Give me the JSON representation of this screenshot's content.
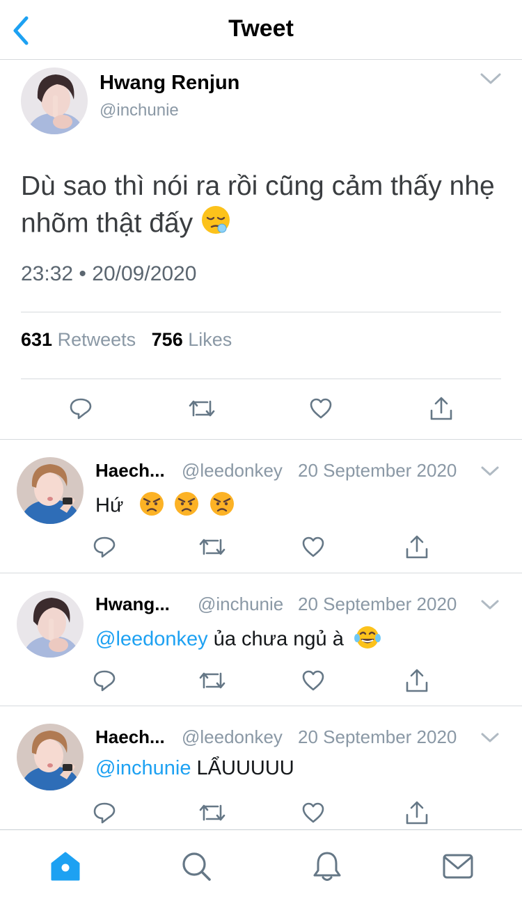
{
  "header": {
    "title": "Tweet",
    "back_icon": "chevron-left-icon",
    "accent": "#1da1f2"
  },
  "main_tweet": {
    "author_name": "Hwang Renjun",
    "author_handle": "@inchunie",
    "text": "Dù sao thì nói ra rồi cũng cảm thấy nhẹ nhõm thật đấy",
    "emoji": "sleepy-face-emoji",
    "time": "23:32",
    "separator": "•",
    "date": "20/09/2020",
    "retweets_count": "631",
    "retweets_label": "Retweets",
    "likes_count": "756",
    "likes_label": "Likes"
  },
  "replies": [
    {
      "name": "Haech...",
      "handle": "@leedonkey",
      "date": "20 September 2020",
      "mention": "",
      "text": "Hứ",
      "emojis": [
        "angry-face-emoji",
        "angry-face-emoji",
        "angry-face-emoji"
      ]
    },
    {
      "name": "Hwang...",
      "handle": "@inchunie",
      "date": "20 September 2020",
      "mention": "@leedonkey",
      "text": " ủa chưa ngủ à",
      "emojis": [
        "tears-of-joy-emoji"
      ]
    },
    {
      "name": "Haech...",
      "handle": "@leedonkey",
      "date": "20 September 2020",
      "mention": "@inchunie",
      "text": " LẨUUUUU",
      "emojis": []
    }
  ],
  "tabs": [
    {
      "name": "home",
      "icon": "home-icon",
      "active": true
    },
    {
      "name": "search",
      "icon": "search-icon",
      "active": false
    },
    {
      "name": "notifications",
      "icon": "bell-icon",
      "active": false
    },
    {
      "name": "messages",
      "icon": "mail-icon",
      "active": false
    }
  ],
  "colors": {
    "text": "#14171a",
    "secondary": "#8a98a5",
    "divider": "#d6dadd",
    "icon": "#657786"
  }
}
